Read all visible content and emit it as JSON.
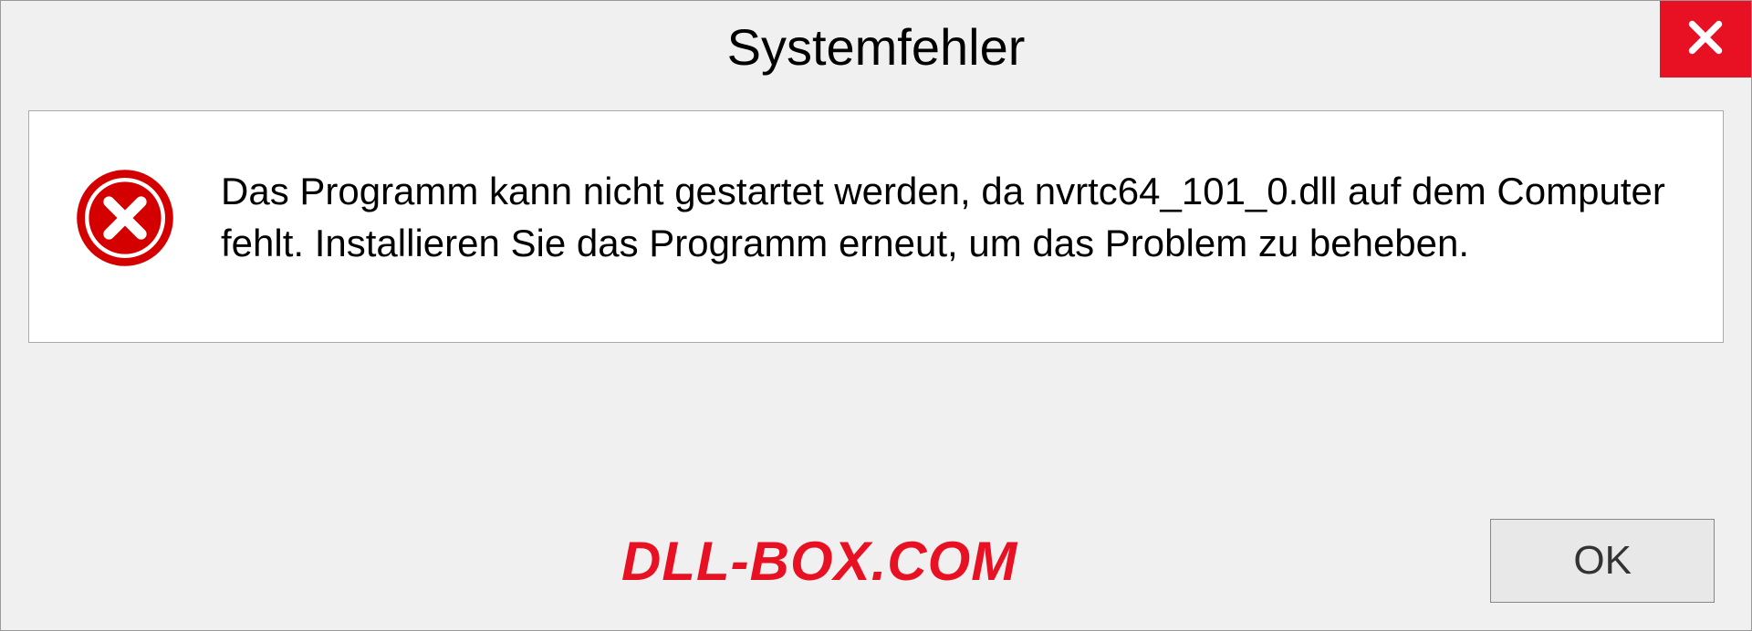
{
  "dialog": {
    "title": "Systemfehler",
    "message": "Das Programm kann nicht gestartet werden, da nvrtc64_101_0.dll auf dem Computer fehlt. Installieren Sie das Programm erneut, um das Problem zu beheben.",
    "ok_label": "OK"
  },
  "watermark": "DLL-BOX.COM",
  "icons": {
    "close": "close-icon",
    "error": "error-icon"
  },
  "colors": {
    "accent_red": "#e81123",
    "background": "#f0f0f0",
    "content_bg": "#fff"
  }
}
